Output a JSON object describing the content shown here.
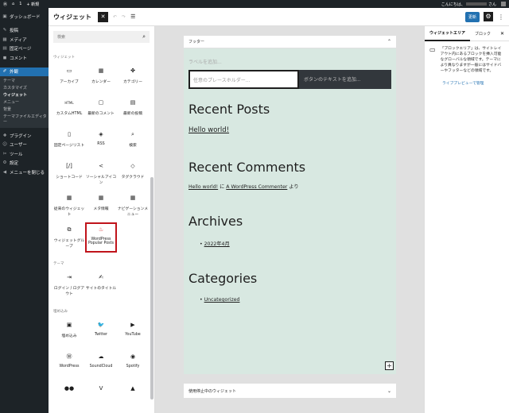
{
  "admin_bar": {
    "updates": "1",
    "new_label": "新規",
    "greeting": "こんにちは、",
    "user_suffix": "さん"
  },
  "sidebar": {
    "items": [
      {
        "icon": "▣",
        "label": "ダッシュボード"
      },
      {
        "icon": "✎",
        "label": "投稿"
      },
      {
        "icon": "▦",
        "label": "メディア"
      },
      {
        "icon": "▤",
        "label": "固定ページ"
      },
      {
        "icon": "◼",
        "label": "コメント"
      },
      {
        "icon": "✐",
        "label": "外観"
      },
      {
        "icon": "✚",
        "label": "プラグイン"
      },
      {
        "icon": "☺",
        "label": "ユーザー"
      },
      {
        "icon": "✂",
        "label": "ツール"
      },
      {
        "icon": "⚙",
        "label": "設定"
      },
      {
        "icon": "◀",
        "label": "メニューを閉じる"
      }
    ],
    "sub": [
      "テーマ",
      "カスタマイズ",
      "ウィジェット",
      "メニュー",
      "背景",
      "テーマファイルエディター"
    ]
  },
  "topbar": {
    "title": "ウィジェット",
    "close": "✕",
    "undo": "↶",
    "redo": "↷",
    "list": "☰",
    "update": "更新",
    "gear": "⚙",
    "more": "⋮"
  },
  "inserter": {
    "search_placeholder": "検索",
    "cat_widgets": "ウィジェット",
    "cat_theme": "テーマ",
    "cat_embed": "埋め込み",
    "widgets": [
      {
        "icon": "▭",
        "label": "アーカイブ"
      },
      {
        "icon": "▦",
        "label": "カレンダー"
      },
      {
        "icon": "✤",
        "label": "カテゴリー"
      },
      {
        "icon": "HTML",
        "label": "カスタムHTML"
      },
      {
        "icon": "▢",
        "label": "最新のコメント"
      },
      {
        "icon": "▤",
        "label": "最新の投稿"
      },
      {
        "icon": "▯",
        "label": "固定ページリスト"
      },
      {
        "icon": "◈",
        "label": "RSS"
      },
      {
        "icon": "⌕",
        "label": "検索"
      },
      {
        "icon": "[/]",
        "label": "ショートコード"
      },
      {
        "icon": "<",
        "label": "ソーシャルアイコン"
      },
      {
        "icon": "◇",
        "label": "タグクラウド"
      },
      {
        "icon": "▦",
        "label": "従来のウィジェット"
      },
      {
        "icon": "▦",
        "label": "メタ情報"
      },
      {
        "icon": "▦",
        "label": "ナビゲーションメニュー"
      },
      {
        "icon": "⧉",
        "label": "ウィジェットグループ"
      },
      {
        "icon": "♨",
        "label": "WordPress Popular Posts"
      }
    ],
    "theme": [
      {
        "icon": "⇥",
        "label": "ログイン / ログアウト"
      },
      {
        "icon": "✍",
        "label": "サイトのタイトル"
      }
    ],
    "embeds": [
      {
        "icon": "▣",
        "label": "埋め込み"
      },
      {
        "icon": "🐦",
        "label": "Twitter"
      },
      {
        "icon": "▶",
        "label": "YouTube"
      },
      {
        "icon": "Ⓦ",
        "label": "WordPress"
      },
      {
        "icon": "☁",
        "label": "SoundCloud"
      },
      {
        "icon": "◉",
        "label": "Spotify"
      },
      {
        "icon": "●●",
        "label": ""
      },
      {
        "icon": "V",
        "label": ""
      },
      {
        "icon": "▲",
        "label": ""
      }
    ]
  },
  "editor": {
    "area_title": "フッター",
    "search_label": "ラベルを追加...",
    "search_placeholder": "任意のプレースホルダー...",
    "search_button": "ボタンのテキストを追加...",
    "recent_posts": "Recent Posts",
    "post1": "Hello world!",
    "recent_comments": "Recent Comments",
    "comment_post": "Hello world!",
    "comment_on": "に",
    "commenter": "A WordPress Commenter",
    "comment_by": "より",
    "archives": "Archives",
    "archive1": "2022年4月",
    "categories": "Categories",
    "category1": "Uncategorized",
    "inactive_area": "使用停止中のウィジェット"
  },
  "panel": {
    "tab_area": "ウィジェットエリア",
    "tab_block": "ブロック",
    "close": "✕",
    "desc": "「ブロックエリア」は、サイトレイアウト内にあるブロックを挿入可能なグローバルな領域です。テーマにより異なりますが一般にはサイドバーやフッターなどの領域です。",
    "preview_link": "ライブプレビューで管理"
  }
}
